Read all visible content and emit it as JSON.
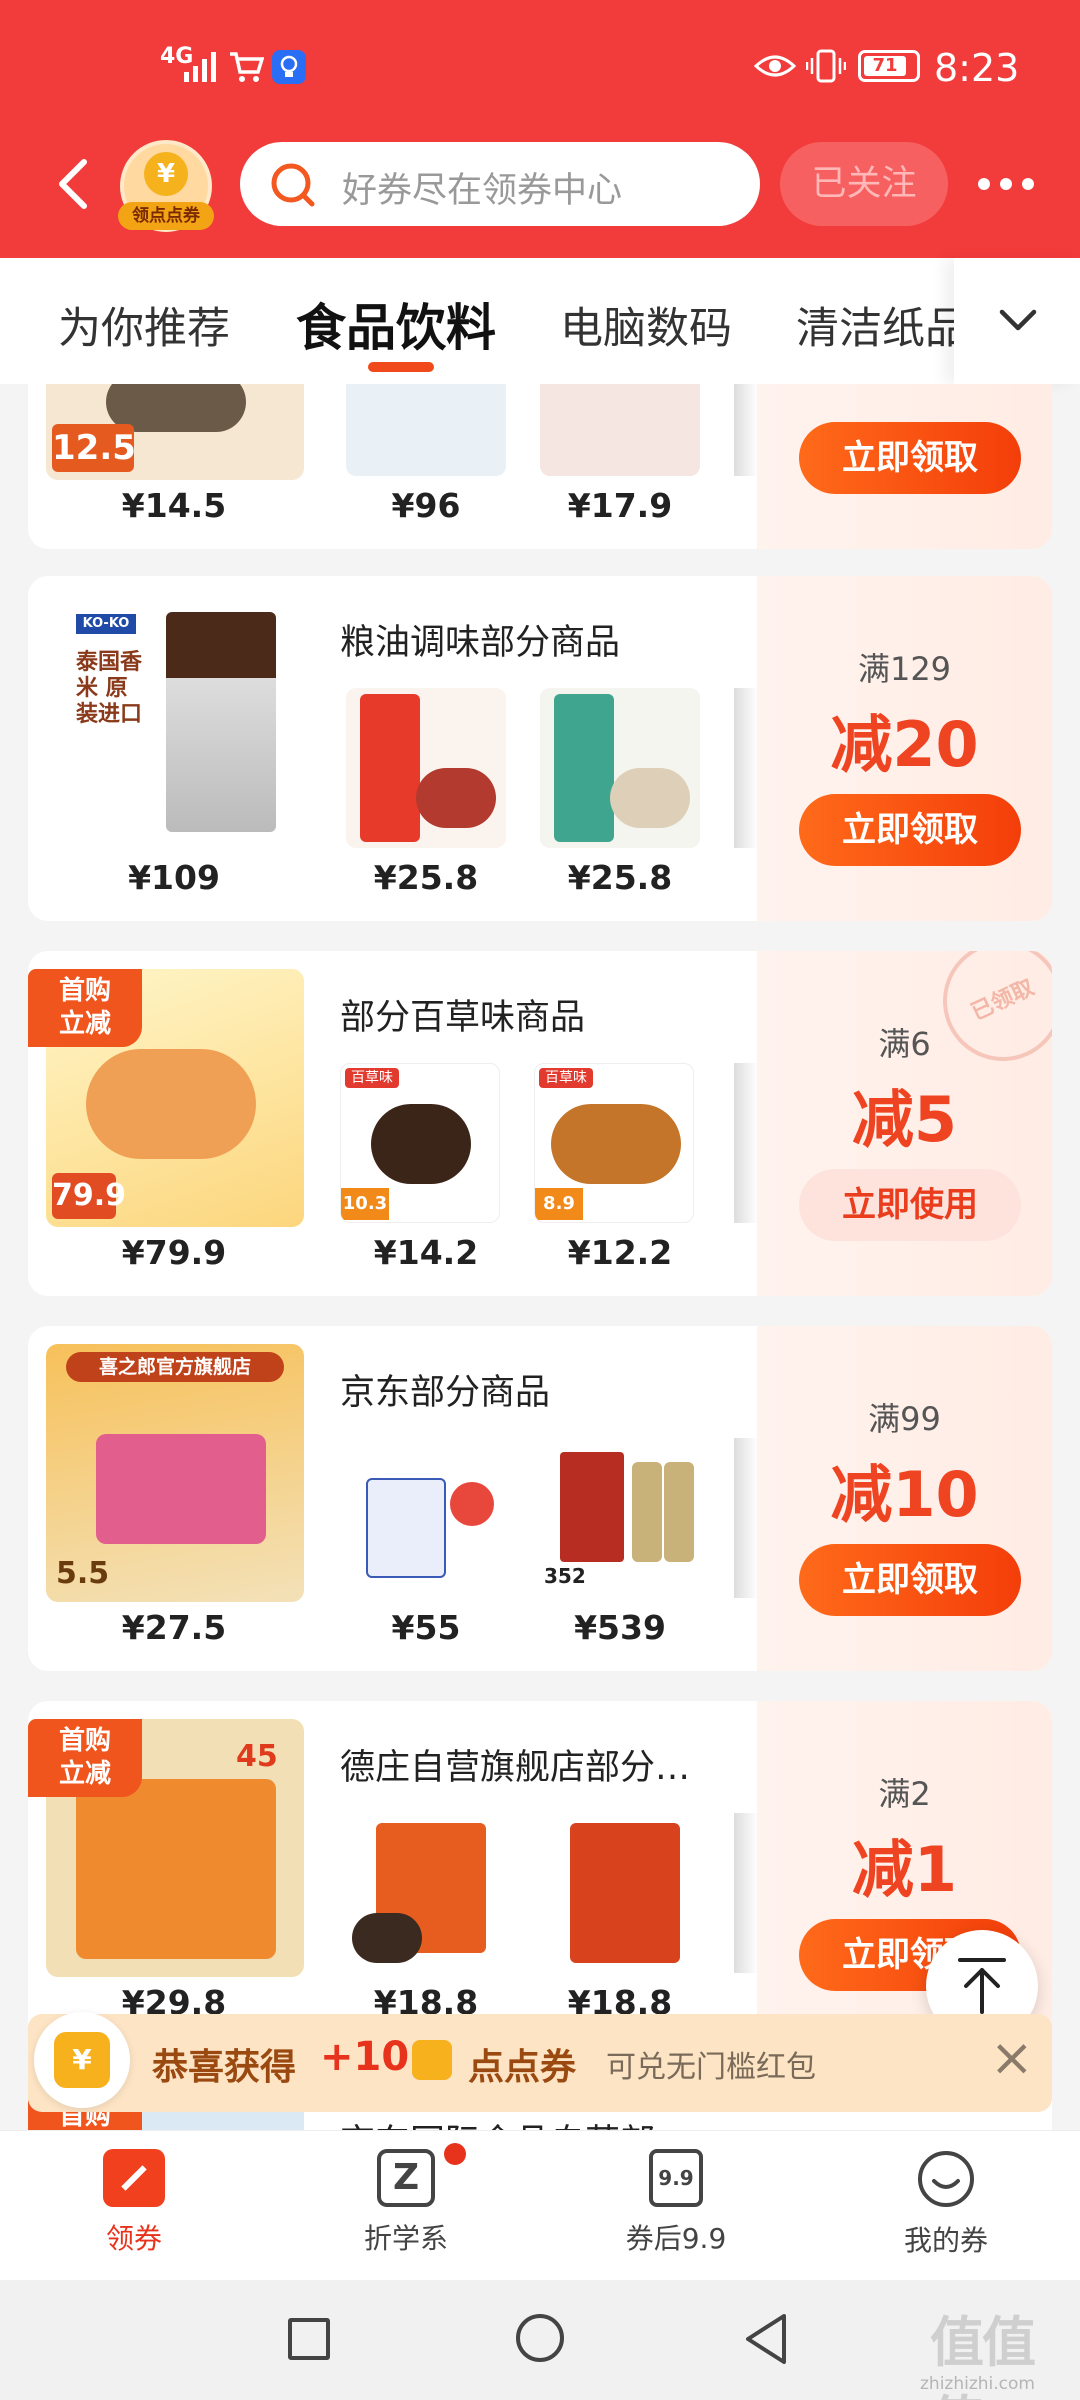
{
  "status_bar": {
    "network": "4G",
    "battery": "71",
    "time": "8:23"
  },
  "header": {
    "avatar_badge": "领点点券",
    "search_placeholder": "好券尽在领券中心",
    "follow_label": "已关注",
    "more_label": "•••"
  },
  "tabs": [
    "为你推荐",
    "食品饮料",
    "电脑数码",
    "清洁纸品"
  ],
  "active_tab_index": 1,
  "cards": [
    {
      "title": "",
      "main_price": "¥14.5",
      "main_tag": "12.5",
      "thumb_prices": [
        "¥96",
        "¥17.9"
      ],
      "threshold": "",
      "amount": "",
      "button": "立即领取"
    },
    {
      "title": "粮油调味部分商品",
      "main_price": "¥109",
      "main_brand": "KO-KO",
      "main_caption": "泰国香米 原装进口",
      "thumb_prices": [
        "¥25.8",
        "¥25.8"
      ],
      "threshold": "满129",
      "amount": "减20",
      "button": "立即领取"
    },
    {
      "title": "部分百草味商品",
      "badge": "首购\n立减",
      "main_price": "¥79.9",
      "main_tag": "79.9",
      "thumb_prices": [
        "¥14.2",
        "¥12.2"
      ],
      "thumb_tags": [
        "10.3",
        "8.9"
      ],
      "thumb_brand": "百草味",
      "threshold": "满6",
      "amount": "减5",
      "button": "立即使用",
      "stamp": "已领取"
    },
    {
      "title": "京东部分商品",
      "main_price": "¥27.5",
      "main_caption": "喜之郎官方旗舰店",
      "main_tag": "5.5",
      "thumb_prices": [
        "¥55",
        "¥539"
      ],
      "thumb_tags": [
        "",
        "352"
      ],
      "threshold": "满99",
      "amount": "减10",
      "button": "立即领取"
    },
    {
      "title": "德庄自营旗舰店部分…",
      "badge": "首购\n立减",
      "main_price": "¥29.8",
      "main_tag": "45",
      "thumb_prices": [
        "¥18.8",
        "¥18.8"
      ],
      "threshold": "满2",
      "amount": "减1",
      "button": "立即领取"
    },
    {
      "title": "京东国际食品自营部",
      "badge": "首购",
      "main_price": "",
      "thumb_prices": [],
      "threshold": "",
      "amount": "",
      "button": ""
    }
  ],
  "toast": {
    "prefix": "恭喜获得",
    "amount": "+10",
    "coupon_name": "点点券",
    "desc": "可兑无门槛红包",
    "close": "×"
  },
  "bottom_nav": [
    {
      "label": "领券",
      "icon": "coupon-icon",
      "active": true
    },
    {
      "label": "折学系",
      "icon": "z-icon",
      "active": false
    },
    {
      "label": "券后9.9",
      "icon": "nine-nine-icon",
      "active": false
    },
    {
      "label": "我的券",
      "icon": "my-coupon-icon",
      "active": false
    }
  ],
  "watermark": {
    "logo": "值值值",
    "domain": "zhizhizhi.com"
  },
  "colors": {
    "brand_red": "#f23b3b",
    "coupon_orange": "#ef4422",
    "active_tab_underline": "#f04a1c"
  }
}
